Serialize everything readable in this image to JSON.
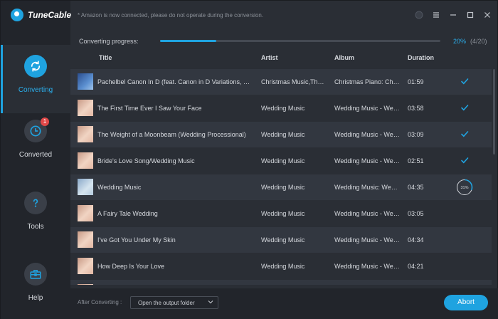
{
  "app": {
    "name": "TuneCable"
  },
  "notice": "* Amazon is now connected, please do not operate during the conversion.",
  "nav": [
    {
      "label": "Converting",
      "icon": "sync-icon",
      "active": true
    },
    {
      "label": "Converted",
      "icon": "clock-icon",
      "badge": "1"
    },
    {
      "label": "Tools",
      "icon": "question-icon"
    },
    {
      "label": "Help",
      "icon": "toolbox-icon"
    }
  ],
  "progress": {
    "label": "Converting progress:",
    "percent": "20%",
    "count": "(4/20)",
    "fraction": 0.2
  },
  "columns": {
    "title": "Title",
    "artist": "Artist",
    "album": "Album",
    "duration": "Duration"
  },
  "rows": [
    {
      "title": "Pachelbel Canon In D (feat. Canon in D Variations, We...",
      "artist": "Christmas Music,The ...",
      "album": "Christmas Piano: Chri...",
      "duration": "01:59",
      "status": "done",
      "thumb": "blue"
    },
    {
      "title": "The First Time Ever I Saw Your Face",
      "artist": "Wedding Music",
      "album": "Wedding Music - Wed...",
      "duration": "03:58",
      "status": "done",
      "thumb": "portrait"
    },
    {
      "title": "The Weight of a Moonbeam (Wedding Processional)",
      "artist": "Wedding Music",
      "album": "Wedding Music - Wed...",
      "duration": "03:09",
      "status": "done",
      "thumb": "portrait"
    },
    {
      "title": "Bride's Love Song/Wedding Music",
      "artist": "Wedding Music",
      "album": "Wedding Music - Wed...",
      "duration": "02:51",
      "status": "done",
      "thumb": "portrait"
    },
    {
      "title": "Wedding Music",
      "artist": "Wedding Music",
      "album": "Wedding Music: Wed...",
      "duration": "04:35",
      "status": "converting",
      "progress": "31%",
      "progress_fraction": 0.31,
      "thumb": "pale"
    },
    {
      "title": "A Fairy Tale Wedding",
      "artist": "Wedding Music",
      "album": "Wedding Music - Wed...",
      "duration": "03:05",
      "status": "pending",
      "thumb": "portrait"
    },
    {
      "title": "I've Got You Under My Skin",
      "artist": "Wedding Music",
      "album": "Wedding Music - Wed...",
      "duration": "04:34",
      "status": "pending",
      "thumb": "portrait"
    },
    {
      "title": "How Deep Is Your Love",
      "artist": "Wedding Music",
      "album": "Wedding Music - Wed...",
      "duration": "04:21",
      "status": "pending",
      "thumb": "portrait"
    },
    {
      "title": "",
      "artist": "",
      "album": "",
      "duration": "",
      "status": "pending",
      "thumb": "portrait"
    }
  ],
  "footer": {
    "after_label": "After Converting :",
    "after_option": "Open the output folder",
    "abort_label": "Abort"
  },
  "colors": {
    "accent": "#1fa3e0",
    "background": "#2a2e35",
    "sidebar": "#22252b",
    "badge": "#e04848"
  }
}
